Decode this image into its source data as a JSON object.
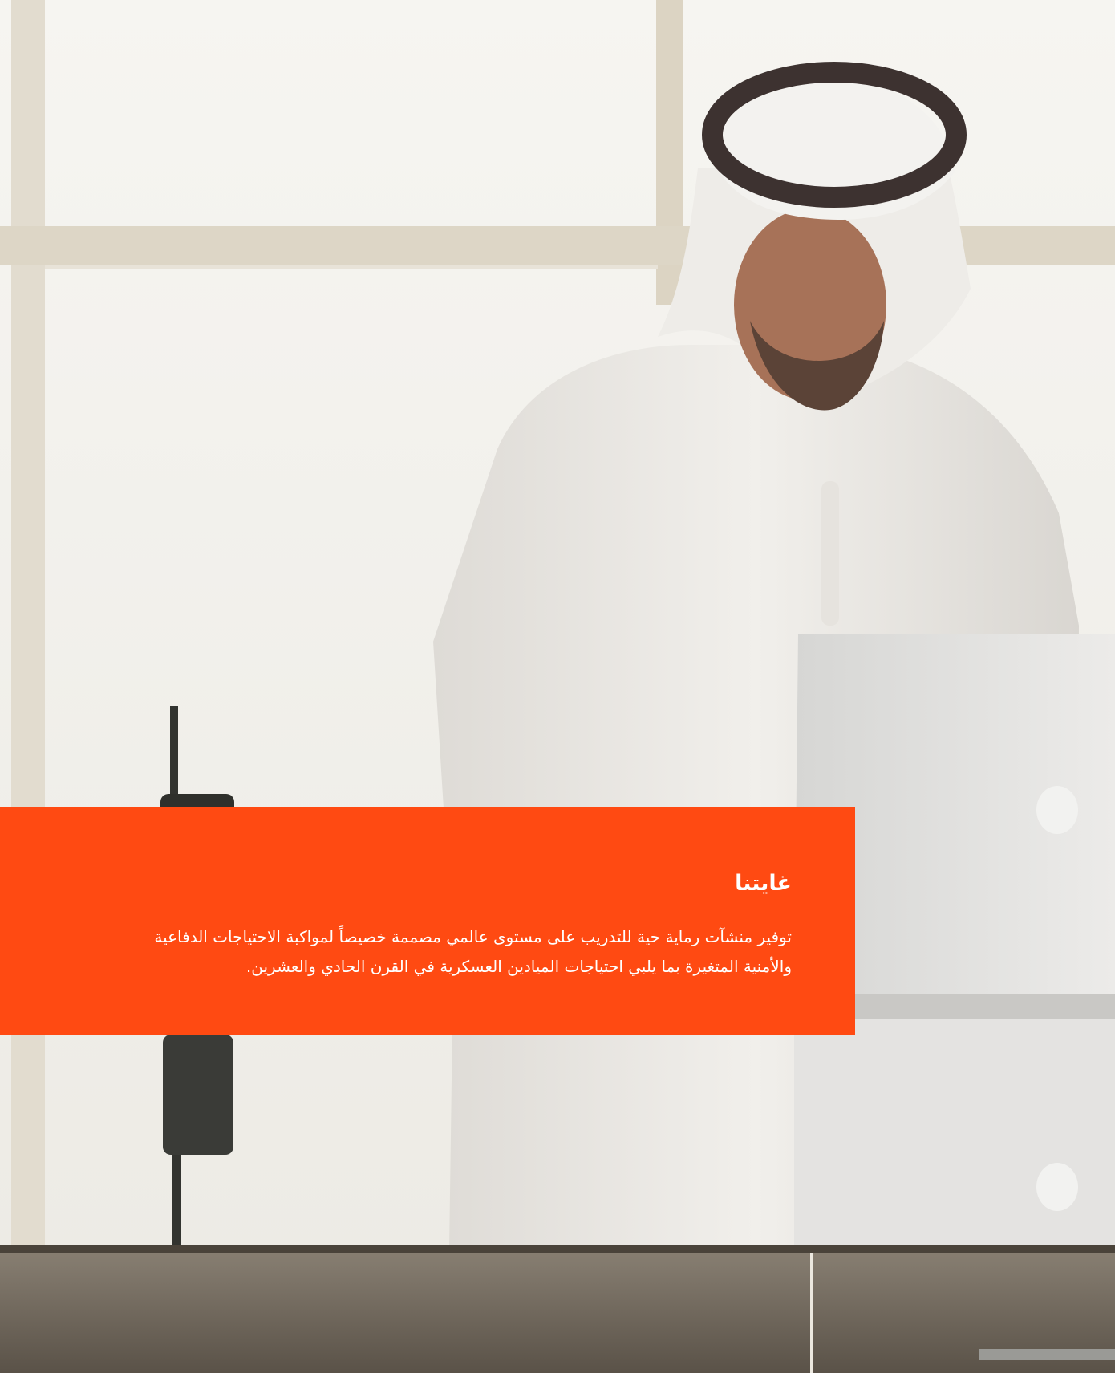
{
  "photo": {
    "alt_icon": "photo-man-at-laptop",
    "colors": {
      "window_bg": "#f4f3ef",
      "window_frame": "#d9d2c3",
      "robe": "#ebe8e3",
      "agal": "#3d3230",
      "skin": "#a77258",
      "laptop": "#e1e1df",
      "desk": "#6d6457",
      "radio": "#2f302c"
    }
  },
  "mission": {
    "title": "غايتنا",
    "lines": [
      "توفير منشآت رماية حية للتدريب على مستوى عالمي مصممة خصيصاً لمواكبة الاحتياجات الدفاعية",
      "والأمنية المتغيرة بما يلبي احتياجات الميادين العسكرية في القرن الحادي والعشرين."
    ],
    "accent": "#ff4a12"
  }
}
